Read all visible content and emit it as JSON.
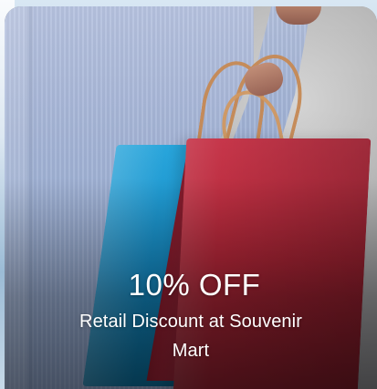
{
  "promo_card": {
    "discount": "10% OFF",
    "description": "Retail Discount at Souvenir Mart",
    "image_alt": "Person holding shopping bags"
  }
}
